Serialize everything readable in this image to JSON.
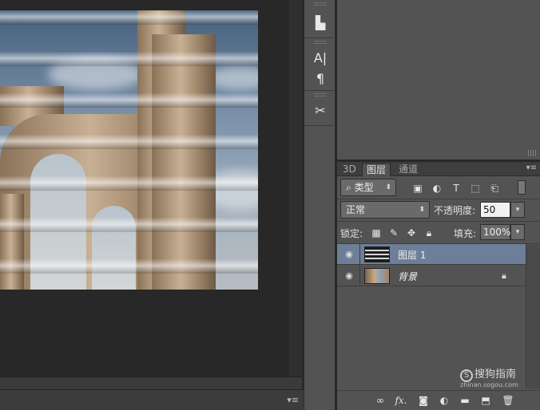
{
  "colors": {
    "selection": "#6d7f98",
    "panel": "#535353",
    "workspace": "#282828"
  },
  "toolstrip": {
    "items": [
      {
        "name": "clone-source-icon",
        "glyph": "▙"
      },
      {
        "name": "character-icon",
        "glyph": "A|"
      },
      {
        "name": "paragraph-icon",
        "glyph": "¶"
      },
      {
        "name": "tool-presets-icon",
        "glyph": "✂"
      }
    ]
  },
  "layers_panel": {
    "tabs": [
      "3D",
      "图层",
      "通道"
    ],
    "filter": {
      "label": "类型"
    },
    "blend_mode": "正常",
    "opacity_label": "不透明度:",
    "opacity_value": "50",
    "lock_label": "锁定:",
    "fill_label": "填充:",
    "fill_value": "100%",
    "layers": [
      {
        "name": "图层 1",
        "visible": true,
        "selected": true
      },
      {
        "name": "背景",
        "visible": true,
        "locked": true
      }
    ],
    "bottom_icons": [
      "link-icon",
      "fx-icon",
      "mask-icon",
      "adjustment-icon",
      "folder-icon",
      "new-layer-icon",
      "trash-icon"
    ],
    "fx_label": "fx."
  },
  "watermark": {
    "brand": "搜狗指南",
    "logo": "S",
    "url": "zhinan.sogou.com"
  }
}
